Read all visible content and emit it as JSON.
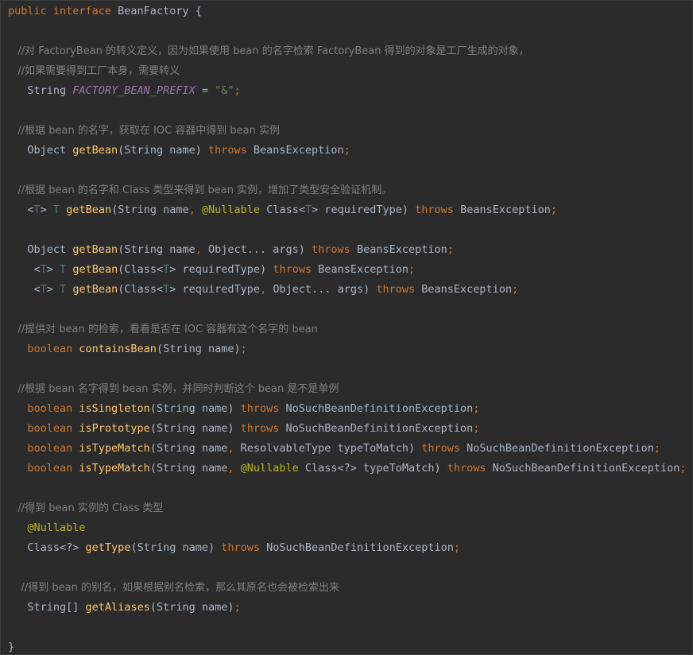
{
  "editor": {
    "language": "java",
    "lines": [
      [
        {
          "t": "public interface ",
          "c": "kw"
        },
        {
          "t": "BeanFactory {",
          "c": "pl"
        }
      ],
      [],
      [
        {
          "t": "   //对 FactoryBean 的转义定义，因为如果使用 bean 的名字检索 FactoryBean 得到的对象是工厂生成的对象，",
          "c": "cm"
        }
      ],
      [
        {
          "t": "   //如果需要得到工厂本身，需要转义",
          "c": "cm"
        }
      ],
      [
        {
          "t": "   String ",
          "c": "pl"
        },
        {
          "t": "FACTORY_BEAN_PREFIX",
          "c": "cn"
        },
        {
          "t": " = ",
          "c": "pl"
        },
        {
          "t": "\"&\"",
          "c": "st"
        },
        {
          "t": ";",
          "c": "kw"
        }
      ],
      [],
      [
        {
          "t": "   //根据 bean 的名字，获取在 IOC 容器中得到 bean 实例",
          "c": "cm"
        }
      ],
      [
        {
          "t": "   Object ",
          "c": "pl"
        },
        {
          "t": "getBean",
          "c": "fn"
        },
        {
          "t": "(String name) ",
          "c": "pl"
        },
        {
          "t": "throws ",
          "c": "kw"
        },
        {
          "t": "BeansException",
          "c": "pl"
        },
        {
          "t": ";",
          "c": "kw"
        }
      ],
      [],
      [
        {
          "t": "   //根据 bean 的名字和 Class 类型来得到 bean 实例，增加了类型安全验证机制。",
          "c": "cm"
        }
      ],
      [
        {
          "t": "   <",
          "c": "pl"
        },
        {
          "t": "T",
          "c": "tp"
        },
        {
          "t": "> ",
          "c": "pl"
        },
        {
          "t": "T ",
          "c": "tp"
        },
        {
          "t": "getBean",
          "c": "fn"
        },
        {
          "t": "(String name",
          "c": "pl"
        },
        {
          "t": ", ",
          "c": "kw"
        },
        {
          "t": "@Nullable ",
          "c": "an"
        },
        {
          "t": "Class<",
          "c": "pl"
        },
        {
          "t": "T",
          "c": "tp"
        },
        {
          "t": "> requiredType) ",
          "c": "pl"
        },
        {
          "t": "throws ",
          "c": "kw"
        },
        {
          "t": "BeansException",
          "c": "pl"
        },
        {
          "t": ";",
          "c": "kw"
        }
      ],
      [],
      [
        {
          "t": "   Object ",
          "c": "pl"
        },
        {
          "t": "getBean",
          "c": "fn"
        },
        {
          "t": "(String name",
          "c": "pl"
        },
        {
          "t": ", ",
          "c": "kw"
        },
        {
          "t": "Object... args) ",
          "c": "pl"
        },
        {
          "t": "throws ",
          "c": "kw"
        },
        {
          "t": "BeansException",
          "c": "pl"
        },
        {
          "t": ";",
          "c": "kw"
        }
      ],
      [
        {
          "t": "    <",
          "c": "pl"
        },
        {
          "t": "T",
          "c": "tp"
        },
        {
          "t": "> ",
          "c": "pl"
        },
        {
          "t": "T ",
          "c": "tp"
        },
        {
          "t": "getBean",
          "c": "fn"
        },
        {
          "t": "(Class<",
          "c": "pl"
        },
        {
          "t": "T",
          "c": "tp"
        },
        {
          "t": "> requiredType) ",
          "c": "pl"
        },
        {
          "t": "throws ",
          "c": "kw"
        },
        {
          "t": "BeansException",
          "c": "pl"
        },
        {
          "t": ";",
          "c": "kw"
        }
      ],
      [
        {
          "t": "    <",
          "c": "pl"
        },
        {
          "t": "T",
          "c": "tp"
        },
        {
          "t": "> ",
          "c": "pl"
        },
        {
          "t": "T ",
          "c": "tp"
        },
        {
          "t": "getBean",
          "c": "fn"
        },
        {
          "t": "(Class<",
          "c": "pl"
        },
        {
          "t": "T",
          "c": "tp"
        },
        {
          "t": "> requiredType",
          "c": "pl"
        },
        {
          "t": ", ",
          "c": "kw"
        },
        {
          "t": "Object... args) ",
          "c": "pl"
        },
        {
          "t": "throws ",
          "c": "kw"
        },
        {
          "t": "BeansException",
          "c": "pl"
        },
        {
          "t": ";",
          "c": "kw"
        }
      ],
      [],
      [
        {
          "t": "   //提供对 bean 的检索，看看是否在 IOC 容器有这个名字的 bean",
          "c": "cm"
        }
      ],
      [
        {
          "t": "   boolean ",
          "c": "kw"
        },
        {
          "t": "containsBean",
          "c": "fn"
        },
        {
          "t": "(String name)",
          "c": "pl"
        },
        {
          "t": ";",
          "c": "kw"
        }
      ],
      [],
      [
        {
          "t": "   //根据 bean 名字得到 bean 实例，并同时判断这个 bean 是不是单例",
          "c": "cm"
        }
      ],
      [
        {
          "t": "   boolean ",
          "c": "kw"
        },
        {
          "t": "isSingleton",
          "c": "fn"
        },
        {
          "t": "(String name) ",
          "c": "pl"
        },
        {
          "t": "throws ",
          "c": "kw"
        },
        {
          "t": "NoSuchBeanDefinitionException",
          "c": "pl"
        },
        {
          "t": ";",
          "c": "kw"
        }
      ],
      [
        {
          "t": "   boolean ",
          "c": "kw"
        },
        {
          "t": "isPrototype",
          "c": "fn"
        },
        {
          "t": "(String name) ",
          "c": "pl"
        },
        {
          "t": "throws ",
          "c": "kw"
        },
        {
          "t": "NoSuchBeanDefinitionException",
          "c": "pl"
        },
        {
          "t": ";",
          "c": "kw"
        }
      ],
      [
        {
          "t": "   boolean ",
          "c": "kw"
        },
        {
          "t": "isTypeMatch",
          "c": "fn"
        },
        {
          "t": "(String name",
          "c": "pl"
        },
        {
          "t": ", ",
          "c": "kw"
        },
        {
          "t": "ResolvableType typeToMatch) ",
          "c": "pl"
        },
        {
          "t": "throws ",
          "c": "kw"
        },
        {
          "t": "NoSuchBeanDefinitionException",
          "c": "pl"
        },
        {
          "t": ";",
          "c": "kw"
        }
      ],
      [
        {
          "t": "   boolean ",
          "c": "kw"
        },
        {
          "t": "isTypeMatch",
          "c": "fn"
        },
        {
          "t": "(String name",
          "c": "pl"
        },
        {
          "t": ", ",
          "c": "kw"
        },
        {
          "t": "@Nullable ",
          "c": "an"
        },
        {
          "t": "Class<?> typeToMatch) ",
          "c": "pl"
        },
        {
          "t": "throws ",
          "c": "kw"
        },
        {
          "t": "NoSuchBeanDefinitionException",
          "c": "pl"
        },
        {
          "t": ";",
          "c": "kw"
        }
      ],
      [],
      [
        {
          "t": "   //得到 bean 实例的 Class 类型",
          "c": "cm"
        }
      ],
      [
        {
          "t": "   @Nullable",
          "c": "an"
        }
      ],
      [
        {
          "t": "   Class<?> ",
          "c": "pl"
        },
        {
          "t": "getType",
          "c": "fn"
        },
        {
          "t": "(String name) ",
          "c": "pl"
        },
        {
          "t": "throws ",
          "c": "kw"
        },
        {
          "t": "NoSuchBeanDefinitionException",
          "c": "pl"
        },
        {
          "t": ";",
          "c": "kw"
        }
      ],
      [],
      [
        {
          "t": "    //得到 bean 的别名，如果根据别名检索，那么其原名也会被检索出来",
          "c": "cm"
        }
      ],
      [
        {
          "t": "   String[] ",
          "c": "pl"
        },
        {
          "t": "getAliases",
          "c": "fn"
        },
        {
          "t": "(String name)",
          "c": "pl"
        },
        {
          "t": ";",
          "c": "kw"
        }
      ],
      [],
      [
        {
          "t": "}",
          "c": "pl"
        }
      ]
    ]
  },
  "colors": {
    "background": "#2b2b2b",
    "keyword": "#cc7832",
    "method": "#ffc66d",
    "annotation": "#bbb529",
    "constant": "#9876aa",
    "string": "#6a8759",
    "comment": "#808080",
    "plain": "#a9b7c6",
    "type_param": "#507874"
  }
}
